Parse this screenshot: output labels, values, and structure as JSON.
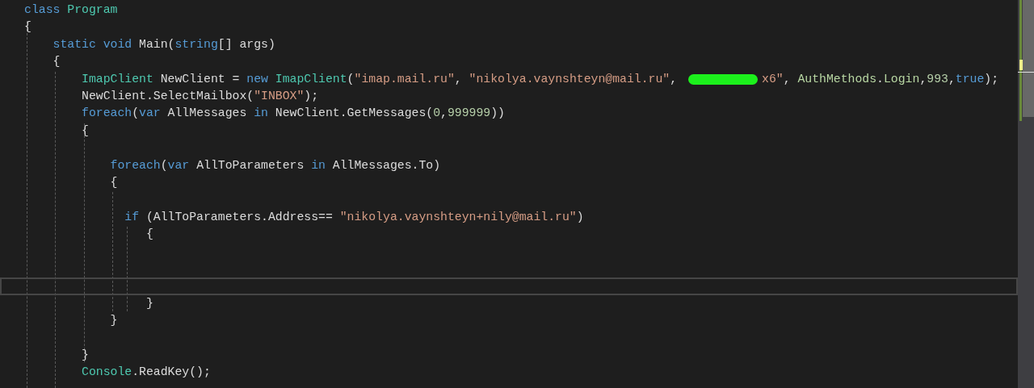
{
  "editor": {
    "lines": [
      {
        "current": false,
        "tokens": [
          {
            "kind": "keyword",
            "text": "class"
          },
          {
            "kind": "type",
            "text": " Program"
          }
        ]
      },
      {
        "current": false,
        "tokens": [
          {
            "kind": "plain",
            "text": "{"
          }
        ]
      },
      {
        "current": false,
        "tokens": [
          {
            "kind": "keyword",
            "text": "    static"
          },
          {
            "kind": "keyword",
            "text": " void"
          },
          {
            "kind": "plain",
            "text": " Main("
          },
          {
            "kind": "keyword",
            "text": "string"
          },
          {
            "kind": "plain",
            "text": "[] args)"
          }
        ]
      },
      {
        "current": false,
        "tokens": [
          {
            "kind": "plain",
            "text": "    {"
          }
        ]
      },
      {
        "current": false,
        "tokens": [
          {
            "kind": "type",
            "text": "        ImapClient"
          },
          {
            "kind": "plain",
            "text": " NewClient = "
          },
          {
            "kind": "keyword",
            "text": "new"
          },
          {
            "kind": "type",
            "text": " ImapClient"
          },
          {
            "kind": "plain",
            "text": "("
          },
          {
            "kind": "string",
            "text": "\"imap.mail.ru\""
          },
          {
            "kind": "plain",
            "text": ", "
          },
          {
            "kind": "string",
            "text": "\"nikolya.vaynshteyn@mail.ru\""
          },
          {
            "kind": "plain",
            "text": ", "
          },
          {
            "kind": "redacted"
          },
          {
            "kind": "string",
            "text": "x6\""
          },
          {
            "kind": "plain",
            "text": ", "
          },
          {
            "kind": "enum",
            "text": "AuthMethods"
          },
          {
            "kind": "plain",
            "text": "."
          },
          {
            "kind": "enum",
            "text": "Login"
          },
          {
            "kind": "plain",
            "text": ","
          },
          {
            "kind": "number",
            "text": "993"
          },
          {
            "kind": "plain",
            "text": ","
          },
          {
            "kind": "keyword",
            "text": "true"
          },
          {
            "kind": "plain",
            "text": ");"
          }
        ]
      },
      {
        "current": false,
        "tokens": [
          {
            "kind": "plain",
            "text": "        NewClient.SelectMailbox("
          },
          {
            "kind": "string",
            "text": "\"INBOX\""
          },
          {
            "kind": "plain",
            "text": ");"
          }
        ]
      },
      {
        "current": false,
        "tokens": [
          {
            "kind": "keyword",
            "text": "        foreach"
          },
          {
            "kind": "plain",
            "text": "("
          },
          {
            "kind": "keyword",
            "text": "var"
          },
          {
            "kind": "plain",
            "text": " AllMessages "
          },
          {
            "kind": "keyword",
            "text": "in"
          },
          {
            "kind": "plain",
            "text": " NewClient.GetMessages("
          },
          {
            "kind": "number",
            "text": "0"
          },
          {
            "kind": "plain",
            "text": ","
          },
          {
            "kind": "number",
            "text": "999999"
          },
          {
            "kind": "plain",
            "text": "))"
          }
        ]
      },
      {
        "current": false,
        "tokens": [
          {
            "kind": "plain",
            "text": "        {"
          }
        ]
      },
      {
        "current": false
      },
      {
        "current": false,
        "tokens": [
          {
            "kind": "keyword",
            "text": "            foreach"
          },
          {
            "kind": "plain",
            "text": "("
          },
          {
            "kind": "keyword",
            "text": "var"
          },
          {
            "kind": "plain",
            "text": " AllToParameters "
          },
          {
            "kind": "keyword",
            "text": "in"
          },
          {
            "kind": "plain",
            "text": " AllMessages.To)"
          }
        ]
      },
      {
        "current": false,
        "tokens": [
          {
            "kind": "plain",
            "text": "            {"
          }
        ]
      },
      {
        "current": false
      },
      {
        "current": false,
        "tokens": [
          {
            "kind": "keyword",
            "text": "              if"
          },
          {
            "kind": "plain",
            "text": " (AllToParameters.Address== "
          },
          {
            "kind": "string",
            "text": "\"nikolya.vaynshteyn+nily@mail.ru\""
          },
          {
            "kind": "plain",
            "text": ")"
          }
        ]
      },
      {
        "current": false,
        "tokens": [
          {
            "kind": "plain",
            "text": "                 {"
          }
        ]
      },
      {
        "current": false
      },
      {
        "current": false
      },
      {
        "current": true
      },
      {
        "current": false,
        "tokens": [
          {
            "kind": "plain",
            "text": "                 }"
          }
        ]
      },
      {
        "current": false,
        "tokens": [
          {
            "kind": "plain",
            "text": "            }"
          }
        ]
      },
      {
        "current": false
      },
      {
        "current": false,
        "tokens": [
          {
            "kind": "plain",
            "text": "        }"
          }
        ]
      },
      {
        "current": false,
        "tokens": [
          {
            "kind": "type",
            "text": "        Console"
          },
          {
            "kind": "plain",
            "text": ".ReadKey();"
          }
        ]
      }
    ]
  }
}
